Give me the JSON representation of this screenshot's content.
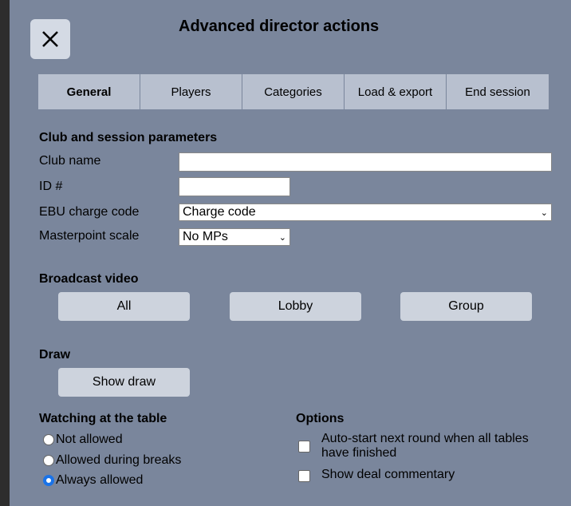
{
  "dialog": {
    "title": "Advanced director actions",
    "close_icon": "close-icon"
  },
  "tabs": [
    {
      "label": "General",
      "active": true
    },
    {
      "label": "Players",
      "active": false
    },
    {
      "label": "Categories",
      "active": false
    },
    {
      "label": "Load & export",
      "active": false
    },
    {
      "label": "End session",
      "active": false
    }
  ],
  "club": {
    "section_title": "Club and session parameters",
    "club_name_label": "Club name",
    "club_name_value": "",
    "id_label": "ID #",
    "id_value": "",
    "charge_code_label": "EBU charge code",
    "charge_code_value": "Charge code",
    "masterpoint_label": "Masterpoint scale",
    "masterpoint_value": "No MPs"
  },
  "broadcast": {
    "section_title": "Broadcast video",
    "buttons": [
      "All",
      "Lobby",
      "Group"
    ]
  },
  "draw": {
    "section_title": "Draw",
    "button": "Show draw"
  },
  "watching": {
    "section_title": "Watching at the table",
    "options": [
      {
        "label": "Not allowed",
        "checked": false
      },
      {
        "label": "Allowed during breaks",
        "checked": false
      },
      {
        "label": "Always allowed",
        "checked": true
      }
    ]
  },
  "options": {
    "section_title": "Options",
    "items": [
      {
        "label_line1": "Auto-start next round when all tables",
        "label_line2": "have finished",
        "checked": false
      },
      {
        "label_line1": "Show deal commentary",
        "label_line2": "",
        "checked": false
      }
    ]
  },
  "colors": {
    "background": "#7a869c",
    "tab": "#b8c0cf",
    "button": "#cdd3dd",
    "radio_accent": "#1a73e8"
  }
}
